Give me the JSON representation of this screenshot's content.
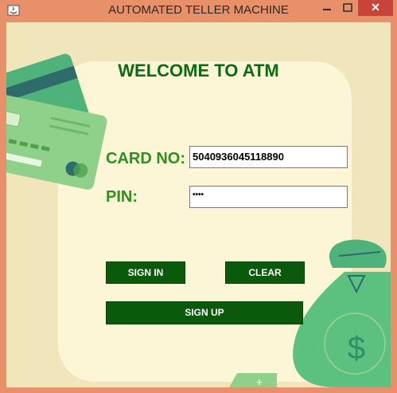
{
  "window": {
    "title": "AUTOMATED TELLER MACHINE",
    "controls": {
      "minimize": "–",
      "maximize": "▢",
      "close": "✕"
    }
  },
  "main": {
    "heading": "WELCOME TO ATM",
    "card_label": "CARD NO:",
    "card_value": "5040936045118890",
    "pin_label": "PIN:",
    "pin_value": "••••",
    "sign_in_label": "SIGN IN",
    "clear_label": "CLEAR",
    "sign_up_label": "SIGN UP"
  },
  "colors": {
    "accent_green": "#0b5a0b",
    "label_green": "#2f8f1f",
    "title_green": "#0b6b12",
    "panel": "#fdf6d6",
    "background": "#f1e6bb",
    "close_red": "#c7443a"
  },
  "icons": [
    "java-app-icon",
    "credit-card-icon",
    "money-bag-icon",
    "dollar-sign-icon"
  ]
}
